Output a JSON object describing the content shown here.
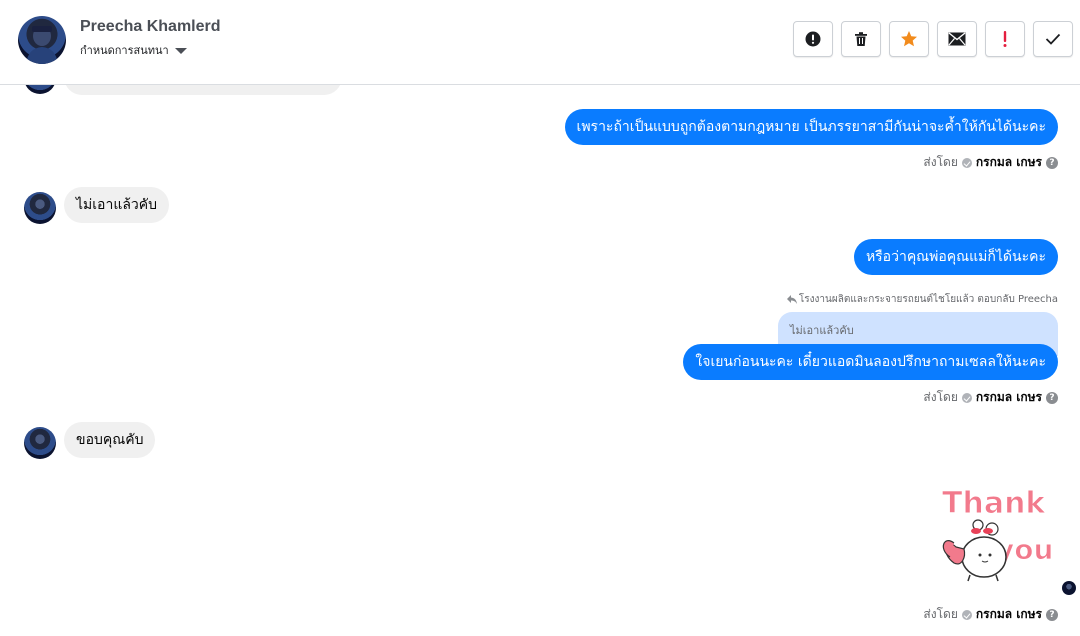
{
  "header": {
    "contact_name": "Preecha Khamlerd",
    "assign_label": "กำหนดการสนทนา",
    "toolbar": [
      {
        "name": "mark-spam-button",
        "icon": "alert-circle-icon"
      },
      {
        "name": "delete-button",
        "icon": "trash-icon"
      },
      {
        "name": "star-button",
        "icon": "star-icon"
      },
      {
        "name": "mark-unread-button",
        "icon": "envelope-icon"
      },
      {
        "name": "follow-up-button",
        "icon": "exclamation-icon"
      },
      {
        "name": "mark-done-button",
        "icon": "checkmark-icon"
      }
    ]
  },
  "messages": {
    "out_1": "เพราะถ้าเป็นแบบถูกต้องตามกฎหมาย เป็นภรรยาสามีกันน่าจะค้ำให้กันได้นะคะ",
    "in_1": "ไม่เอาแล้วคับ",
    "out_2": "หรือว่าคุณพ่อคุณแม่ก็ได้นะคะ",
    "reply_meta": "โรงงานผลิตและกระจายรถยนต์ไชโยแล้ว ตอบกลับ Preecha",
    "quoted": "ไม่เอาแล้วคับ",
    "out_3": "ใจเยนก่อนนะคะ  เดี๋ยวแอดมินลองปรึกษาถามเซลลให้นะคะ",
    "in_2": "ขอบคุณคับ",
    "sticker_text_1": "Thank",
    "sticker_text_2": "you"
  },
  "sent_by": {
    "label": "ส่งโดย",
    "sender": "กรกมล เกษร",
    "help": "?"
  },
  "colors": {
    "outgoing_bubble": "#0a7cff",
    "incoming_bubble": "#f0f0f0",
    "quoted_bubble": "#cfe2ff",
    "star": "#f28b1c",
    "follow_up": "#e41e3f"
  }
}
